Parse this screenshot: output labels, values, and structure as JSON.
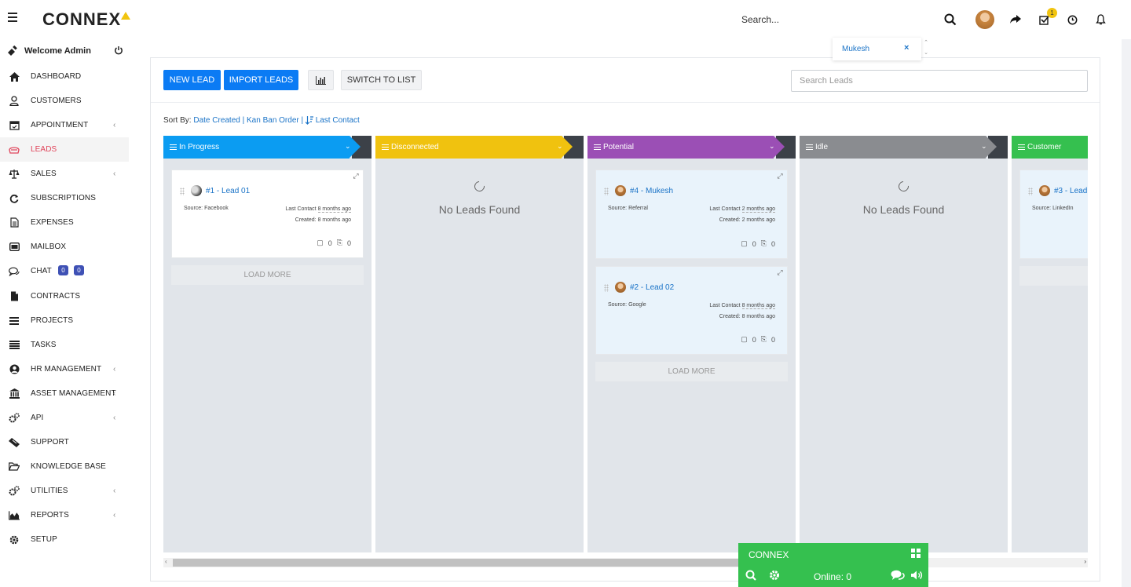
{
  "header": {
    "logo": "CONNEX",
    "search_placeholder": "Search...",
    "notification_count": "1"
  },
  "sidebar": {
    "welcome": "Welcome Admin",
    "items": [
      {
        "label": "DASHBOARD",
        "icon": "home-icon",
        "chevron": false
      },
      {
        "label": "CUSTOMERS",
        "icon": "user-icon",
        "chevron": false
      },
      {
        "label": "APPOINTMENT",
        "icon": "calendar-icon",
        "chevron": true
      },
      {
        "label": "LEADS",
        "icon": "leads-icon",
        "chevron": false
      },
      {
        "label": "SALES",
        "icon": "scale-icon",
        "chevron": true
      },
      {
        "label": "SUBSCRIPTIONS",
        "icon": "refresh-icon",
        "chevron": false
      },
      {
        "label": "EXPENSES",
        "icon": "file-text-icon",
        "chevron": false
      },
      {
        "label": "MAILBOX",
        "icon": "envelope-icon",
        "chevron": false
      },
      {
        "label": "CHAT",
        "icon": "comments-icon",
        "chevron": false
      },
      {
        "label": "CONTRACTS",
        "icon": "file-icon",
        "chevron": false
      },
      {
        "label": "PROJECTS",
        "icon": "bars-icon",
        "chevron": false
      },
      {
        "label": "TASKS",
        "icon": "tasks-icon",
        "chevron": false
      },
      {
        "label": "HR MANAGEMENT",
        "icon": "user-circle-icon",
        "chevron": true
      },
      {
        "label": "ASSET MANAGEMENT",
        "icon": "bank-icon",
        "chevron": true
      },
      {
        "label": "API",
        "icon": "cogs-icon",
        "chevron": true
      },
      {
        "label": "SUPPORT",
        "icon": "ticket-icon",
        "chevron": false
      },
      {
        "label": "KNOWLEDGE BASE",
        "icon": "folder-open-icon",
        "chevron": false
      },
      {
        "label": "UTILITIES",
        "icon": "cogs-icon",
        "chevron": true
      },
      {
        "label": "REPORTS",
        "icon": "area-chart-icon",
        "chevron": true
      },
      {
        "label": "SETUP",
        "icon": "gear-icon",
        "chevron": false
      }
    ],
    "chat_badges": [
      "0",
      "0"
    ],
    "active": "LEADS"
  },
  "toolbar": {
    "new_lead": "NEW LEAD",
    "import_leads": "IMPORT LEADS",
    "switch_to_list": "SWITCH TO LIST",
    "search_placeholder": "Search Leads"
  },
  "sort": {
    "label": "Sort By:",
    "date_created": "Date Created",
    "kanban_order": "Kan Ban Order",
    "last_contact": "Last Contact",
    "sep": "|"
  },
  "columns": [
    {
      "name": "In Progress",
      "color": "#0b9cf2"
    },
    {
      "name": "Disconnected",
      "color": "#f0c20f"
    },
    {
      "name": "Potential",
      "color": "#9b4fb5"
    },
    {
      "name": "Idle",
      "color": "#8a8c90"
    },
    {
      "name": "Customer",
      "color": "#35c04f"
    }
  ],
  "leads": {
    "lead1": {
      "title": "#1 - Lead 01",
      "source": "Source: Facebook",
      "last_contact_label": "Last Contact",
      "last_contact": "8 months ago",
      "created_label": "Created:",
      "created": "8 months ago",
      "notes": "0",
      "attachments": "0"
    },
    "lead4": {
      "title": "#4 - Mukesh",
      "source": "Source: Referral",
      "last_contact_label": "Last Contact",
      "last_contact": "2 months ago",
      "created_label": "Created:",
      "created": "2 months ago",
      "notes": "0",
      "attachments": "0"
    },
    "lead2": {
      "title": "#2 - Lead 02",
      "source": "Source: Google",
      "last_contact_label": "Last Contact",
      "last_contact": "8 months ago",
      "created_label": "Created:",
      "created": "8 months ago",
      "notes": "0",
      "attachments": "0"
    },
    "lead3": {
      "title": "#3 - Lead",
      "source": "Source: LinkedIn"
    }
  },
  "empty_text": "No Leads Found",
  "load_more": "LOAD MORE",
  "popup": {
    "name": "Mukesh",
    "close": "×"
  },
  "chat_widget": {
    "title": "CONNEX",
    "online": "Online: 0"
  }
}
